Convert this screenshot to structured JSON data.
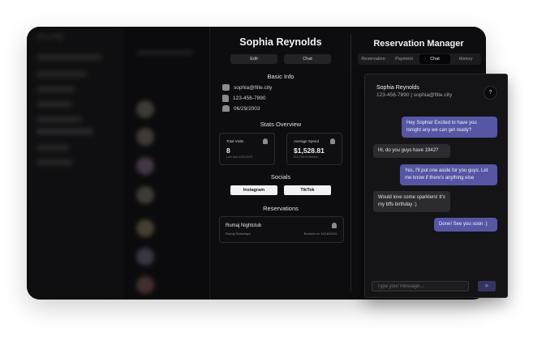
{
  "app": {
    "logo": "FLITE"
  },
  "profile": {
    "name": "Sophia Reynolds",
    "buttons": {
      "edit": "Edit",
      "chat": "Chat"
    },
    "basic_info_title": "Basic Info",
    "email": "sophia@flite.city",
    "phone": "123-456-7890",
    "birthday": "06/29/2003",
    "stats_title": "Stats Overview",
    "stats": [
      {
        "label": "Total Visits",
        "value": "8",
        "sub": "Last visit 10/02/2023"
      },
      {
        "label": "Average Spend",
        "value": "$1,528.81",
        "sub": "$12,230.54 lifetime"
      }
    ],
    "socials_title": "Socials",
    "socials": [
      "Instagram",
      "TikTok"
    ],
    "reservations_title": "Reservations",
    "reservation": {
      "venue": "Rumaj Nightclub",
      "date": "Rumaj Saturdays",
      "booked": "Booked on 10/16/2023"
    }
  },
  "manager": {
    "title": "Reservation Manager",
    "tabs": [
      "Reservation",
      "Payment",
      "Chat",
      "History"
    ],
    "active_tab": "Chat"
  },
  "chat": {
    "name": "Sophia Reynolds",
    "contact": "123-456-7890 | sophia@flite.city",
    "help": "?",
    "messages": [
      {
        "from": "staff",
        "text": "Hey Sophia! Excited to have you tonight any we can get ready?"
      },
      {
        "from": "guest",
        "text": "Hi, do you guys have 1942?"
      },
      {
        "from": "staff",
        "text": "Yes, I'll put one aside for you guys. Let me know if there's anything else"
      },
      {
        "from": "guest",
        "text": "Would love some sparklers! It's my bffs birthday :)"
      },
      {
        "from": "staff",
        "text": "Done! See you soon :)"
      }
    ],
    "input_placeholder": "Type your message...",
    "send_icon": "send-icon",
    "colors": {
      "outgoing": "#5656a4",
      "incoming": "#2b2b30"
    }
  }
}
